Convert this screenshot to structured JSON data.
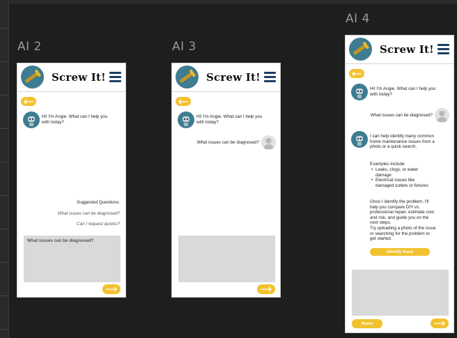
{
  "app": {
    "brand_name": "Screw It!",
    "accent_color": "#f2c12e",
    "brand_color": "#3d7c91",
    "menu_color": "#1c3d63"
  },
  "frames": {
    "ai2": {
      "label": "AI 2",
      "greeting": "Hi! I'm Angie. What can I help you with today?",
      "suggestions_title": "Suggested Questions:",
      "suggestions": [
        "What issues can be diagnosed?",
        "Can I request quotes?"
      ],
      "input_value": "What issues can be diagnosed?"
    },
    "ai3": {
      "label": "AI 3",
      "greeting": "Hi! I'm Angie. What can I help you with today?",
      "user_message": "What issues can be diagnosed?"
    },
    "ai4": {
      "label": "AI 4",
      "greeting": "Hi! I'm Angie. What can I help you with today?",
      "user_message": "What issues can be diagnosed?",
      "reply_intro": "I can help identify many common home maintenance issues from a photo or a quick search.",
      "examples_title": "Examples include:",
      "examples": [
        "Leaks, clogs, or water damage",
        "Electrical issues like damaged outlets or fixtures"
      ],
      "reply_outro": "Once I identify the problem, I'll help you compare DIY vs. professional repair, estimate cost and risk, and guide you on the next steps.",
      "reply_tip": "Try uploading a photo of the issue or searching for the problem to get started.",
      "identify_button": "Identify Issue",
      "home_button": "Home"
    }
  },
  "icons": {
    "logo": "screw-logo-icon",
    "menu": "hamburger-menu-icon",
    "back": "arrow-left-icon",
    "send": "arrow-right-icon",
    "bot": "robot-avatar-icon",
    "user": "user-avatar-icon"
  }
}
